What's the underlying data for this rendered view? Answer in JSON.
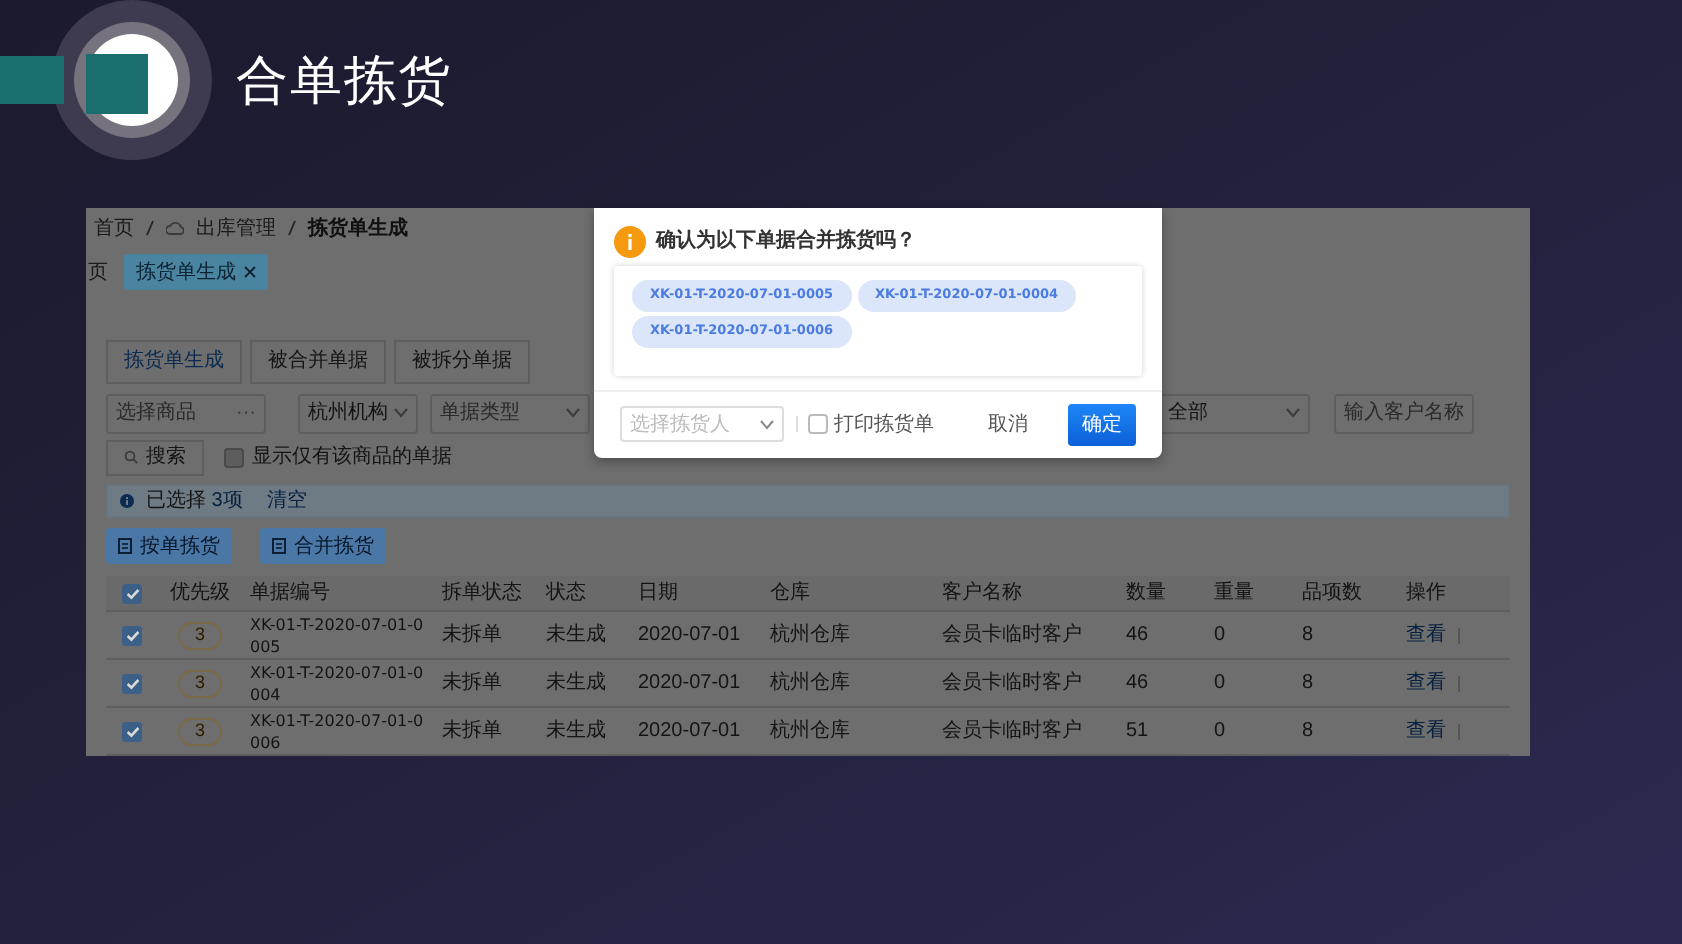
{
  "slide": {
    "title": "合单拣货"
  },
  "app": {
    "breadcrumb": [
      "首页",
      "出库管理",
      "拣货单生成"
    ],
    "page_tabs": [
      {
        "label": "页",
        "selected": false,
        "closable": false
      },
      {
        "label": "拣货单生成",
        "selected": true,
        "closable": true
      }
    ],
    "view_tabs": [
      {
        "label": "拣货单生成",
        "selected": true
      },
      {
        "label": "被合并单据",
        "selected": false
      },
      {
        "label": "被拆分单据",
        "selected": false
      }
    ],
    "filters": {
      "product": {
        "placeholder": "选择商品",
        "button": "···"
      },
      "org": {
        "value": "杭州机构"
      },
      "doc_type": {
        "placeholder": "单据类型"
      },
      "status": {
        "value": "全部"
      },
      "customer": {
        "placeholder": "输入客户名称"
      }
    },
    "search_button": "搜索",
    "only_checkbox": {
      "label": "显示仅有该商品的单据",
      "checked": false
    },
    "selection_alert": {
      "prefix": "已选择",
      "count": "3项",
      "clear": "清空"
    },
    "actions": [
      "按单拣货",
      "合并拣货"
    ],
    "table": {
      "all_checked": true,
      "columns": [
        "优先级",
        "单据编号",
        "拆单状态",
        "状态",
        "日期",
        "仓库",
        "客户名称",
        "数量",
        "重量",
        "品项数",
        "操作"
      ],
      "rows": [
        {
          "checked": true,
          "priority": "3",
          "code": "XK-01-T-2020-07-01-0005",
          "split_status": "未拆单",
          "status": "未生成",
          "date": "2020-07-01",
          "warehouse": "杭州仓库",
          "customer": "会员卡临时客户",
          "qty": "46",
          "weight": "0",
          "items": "8",
          "action": "查看"
        },
        {
          "checked": true,
          "priority": "3",
          "code": "XK-01-T-2020-07-01-0004",
          "split_status": "未拆单",
          "status": "未生成",
          "date": "2020-07-01",
          "warehouse": "杭州仓库",
          "customer": "会员卡临时客户",
          "qty": "46",
          "weight": "0",
          "items": "8",
          "action": "查看"
        },
        {
          "checked": true,
          "priority": "3",
          "code": "XK-01-T-2020-07-01-0006",
          "split_status": "未拆单",
          "status": "未生成",
          "date": "2020-07-01",
          "warehouse": "杭州仓库",
          "customer": "会员卡临时客户",
          "qty": "51",
          "weight": "0",
          "items": "8",
          "action": "查看"
        }
      ]
    }
  },
  "dialog": {
    "title": "确认为以下单据合并拣货吗？",
    "tags": [
      "XK-01-T-2020-07-01-0005",
      "XK-01-T-2020-07-01-0004",
      "XK-01-T-2020-07-01-0006"
    ],
    "picker": {
      "placeholder": "选择拣货人"
    },
    "print": {
      "label": "打印拣货单",
      "checked": false
    },
    "cancel": "取消",
    "confirm": "确定"
  }
}
